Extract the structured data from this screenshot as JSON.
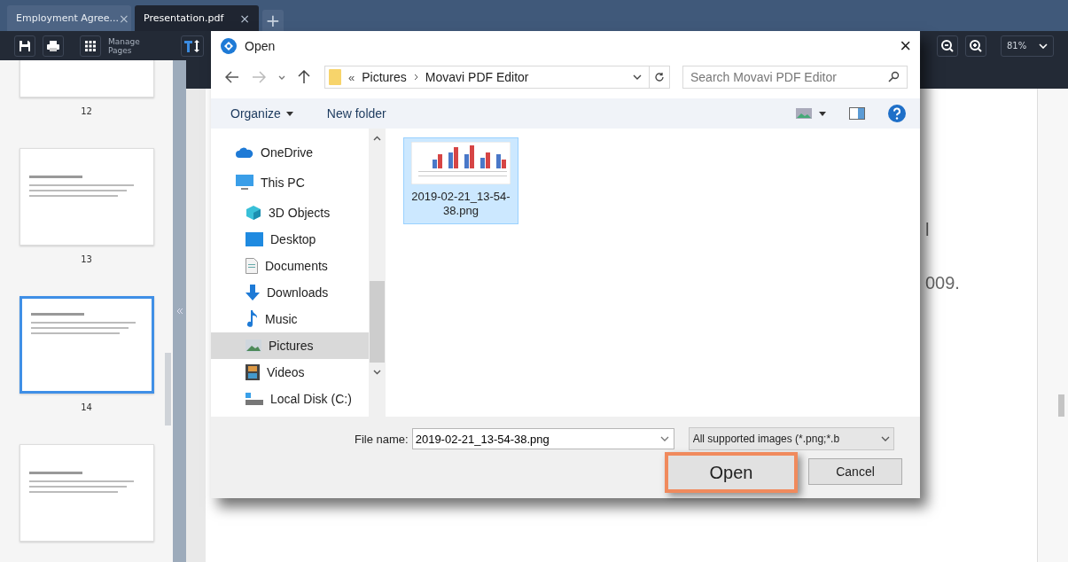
{
  "tabs": [
    {
      "label": "Employment Agree...",
      "close": "×",
      "selected": false
    },
    {
      "label": "Presentation.pdf",
      "close": "×",
      "selected": true
    }
  ],
  "new_tab": "+",
  "toolbar": {
    "manage_pages": "Manage Pages",
    "zoom": "81%"
  },
  "thumbnails": [
    {
      "number": "12",
      "selected": false
    },
    {
      "number": "13",
      "selected": false
    },
    {
      "number": "14",
      "selected": true
    },
    {
      "selected": false
    }
  ],
  "document": {
    "lines": [
      "l",
      "009."
    ]
  },
  "dialog": {
    "title": "Open",
    "close": "×",
    "address": {
      "overflow": "«",
      "path": [
        "Pictures",
        "Movavi PDF Editor"
      ]
    },
    "search": {
      "placeholder": "Search Movavi PDF Editor"
    },
    "commands": {
      "organize": "Organize",
      "new_folder": "New folder"
    },
    "nav": [
      {
        "label": "OneDrive",
        "kind": "cloud",
        "selected": false
      },
      {
        "label": "This PC",
        "kind": "computer",
        "selected": false,
        "children": [
          {
            "label": "3D Objects",
            "kind": "cube",
            "selected": false
          },
          {
            "label": "Desktop",
            "kind": "desktop",
            "selected": false
          },
          {
            "label": "Documents",
            "kind": "document",
            "selected": false
          },
          {
            "label": "Downloads",
            "kind": "download",
            "selected": false
          },
          {
            "label": "Music",
            "kind": "music",
            "selected": false
          },
          {
            "label": "Pictures",
            "kind": "picture",
            "selected": true
          },
          {
            "label": "Videos",
            "kind": "video",
            "selected": false
          },
          {
            "label": "Local Disk (C:)",
            "kind": "disk",
            "selected": false
          }
        ]
      }
    ],
    "files": [
      {
        "name": "2019-02-21_13-54-38.png",
        "selected": true
      }
    ],
    "file_name": {
      "label": "File name:",
      "value": "2019-02-21_13-54-38.png"
    },
    "file_type": "All supported images (*.png;*.b",
    "buttons": [
      {
        "label": "Open",
        "highlighted": true
      },
      {
        "label": "Cancel",
        "highlighted": false
      }
    ]
  }
}
